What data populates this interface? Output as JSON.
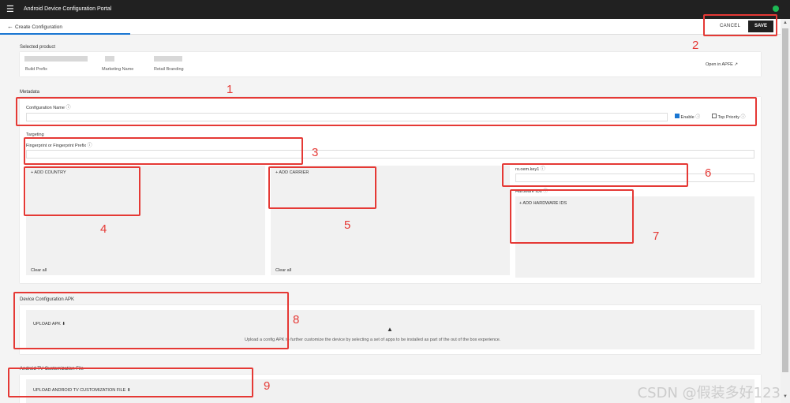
{
  "topbar": {
    "title": "Android Device Configuration Portal"
  },
  "subheader": {
    "back_label": "Create Configuration",
    "cancel_label": "CANCEL",
    "save_label": "SAVE"
  },
  "selected_product": {
    "heading": "Selected product",
    "build_prefix_label": "Build Prefix",
    "marketing_name_label": "Marketing Name",
    "retail_branding_label": "Retail Branding",
    "open_link": "Open in APFE"
  },
  "metadata": {
    "heading": "Metadata",
    "config_name_label": "Configuration Name",
    "enable_label": "Enable",
    "top_priority_label": "Top Priority"
  },
  "targeting": {
    "heading": "Targeting",
    "fingerprint_label": "Fingerprint or Fingerprint Prefix",
    "add_country": "+ ADD COUNTRY",
    "add_carrier": "+ ADD CARRIER",
    "oem_key_label": "ro.oem.key1",
    "hardware_ids_label": "Hardware IDs",
    "add_hardware": "+ ADD HARDWARE IDS",
    "clear_all": "Clear all"
  },
  "apk": {
    "heading": "Device Configuration APK",
    "upload_label": "UPLOAD APK",
    "description": "Upload a config APK to further customize the device by selecting a set of apps to be installed as part of the out of the box experience."
  },
  "tv": {
    "heading": "Android TV Customization File",
    "upload_label": "UPLOAD ANDROID TV CUSTOMIZATION FILE"
  },
  "annotations": [
    "1",
    "2",
    "3",
    "4",
    "5",
    "6",
    "7",
    "8",
    "9"
  ],
  "watermark": "CSDN @假装多好123",
  "colors": {
    "topbar": "#212121",
    "accent": "#1976d2",
    "annotation": "#e53935",
    "save_bg": "#212121"
  }
}
